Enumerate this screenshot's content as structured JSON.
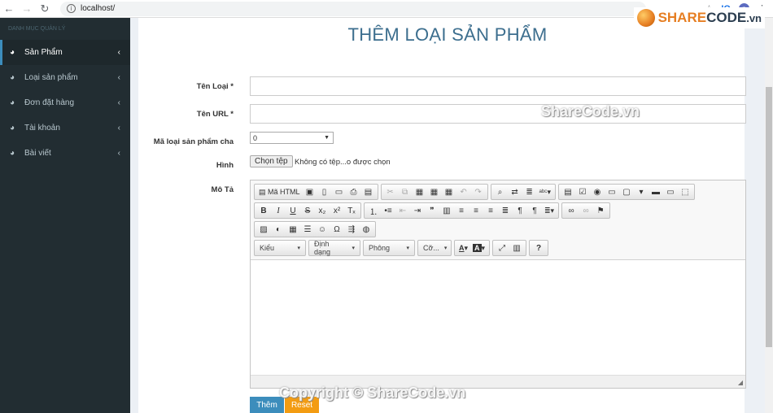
{
  "browser": {
    "url": "localhost/",
    "badge": "IQ",
    "avatar": "n"
  },
  "logo": {
    "text_orange": "SHARE",
    "text_dark": "CODE",
    "text_suffix": ".vn"
  },
  "sidebar": {
    "header": "DANH MỤC QUẢN LÝ",
    "items": [
      {
        "label": "Sản Phẩm",
        "icon": "dashboard-icon"
      },
      {
        "label": "Loại sản phẩm",
        "icon": "dashboard-icon"
      },
      {
        "label": "Đơn đặt hàng",
        "icon": "dashboard-icon"
      },
      {
        "label": "Tài khoản",
        "icon": "dashboard-icon"
      },
      {
        "label": "Bài viết",
        "icon": "dashboard-icon"
      }
    ]
  },
  "form": {
    "title": "THÊM LOẠI SẢN PHẨM",
    "name_label": "Tên Loại *",
    "url_label": "Tên URL *",
    "parent_label": "Mã loại sản phẩm cha",
    "parent_value": "0",
    "image_label": "Hình",
    "file_button": "Chọn tệp",
    "file_status": "Không có tệp...o được chọn",
    "desc_label": "Mô Tả",
    "submit": "Thêm",
    "reset": "Reset"
  },
  "editor": {
    "source_label": "Mã HTML",
    "combo_style": "Kiểu",
    "combo_format": "Định dạng",
    "combo_font": "Phông",
    "combo_size": "Cỡ...",
    "help": "?"
  },
  "watermarks": {
    "center": "ShareCode.vn",
    "bottom": "Copyright © ShareCode.vn"
  }
}
